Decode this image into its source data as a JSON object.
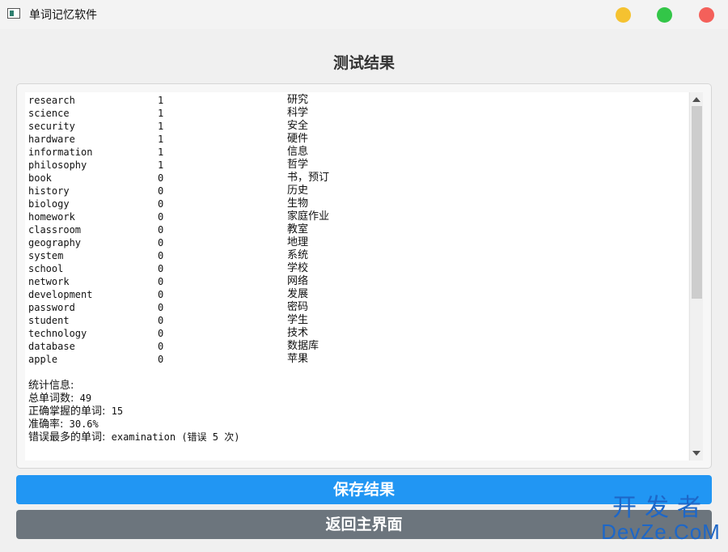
{
  "window": {
    "title": "单词记忆软件"
  },
  "heading": "测试结果",
  "results": [
    {
      "word": "research",
      "count": "1",
      "meaning": "研究"
    },
    {
      "word": "science",
      "count": "1",
      "meaning": "科学"
    },
    {
      "word": "security",
      "count": "1",
      "meaning": "安全"
    },
    {
      "word": "hardware",
      "count": "1",
      "meaning": "硬件"
    },
    {
      "word": "information",
      "count": "1",
      "meaning": "信息"
    },
    {
      "word": "philosophy",
      "count": "1",
      "meaning": "哲学"
    },
    {
      "word": "book",
      "count": "0",
      "meaning": "书，预订"
    },
    {
      "word": "history",
      "count": "0",
      "meaning": "历史"
    },
    {
      "word": "biology",
      "count": "0",
      "meaning": "生物"
    },
    {
      "word": "homework",
      "count": "0",
      "meaning": "家庭作业"
    },
    {
      "word": "classroom",
      "count": "0",
      "meaning": "教室"
    },
    {
      "word": "geography",
      "count": "0",
      "meaning": "地理"
    },
    {
      "word": "system",
      "count": "0",
      "meaning": "系统"
    },
    {
      "word": "school",
      "count": "0",
      "meaning": "学校"
    },
    {
      "word": "network",
      "count": "0",
      "meaning": "网络"
    },
    {
      "word": "development",
      "count": "0",
      "meaning": "发展"
    },
    {
      "word": "password",
      "count": "0",
      "meaning": "密码"
    },
    {
      "word": "student",
      "count": "0",
      "meaning": "学生"
    },
    {
      "word": "technology",
      "count": "0",
      "meaning": "技术"
    },
    {
      "word": "database",
      "count": "0",
      "meaning": "数据库"
    },
    {
      "word": "apple",
      "count": "0",
      "meaning": "苹果"
    }
  ],
  "stats": {
    "title": "统计信息:",
    "total_label": "总单词数:",
    "total_value": "49",
    "correct_label": "正确掌握的单词:",
    "correct_value": "15",
    "accuracy_label": "准确率:",
    "accuracy_value": "30.6%",
    "most_wrong_label": "错误最多的单词:",
    "most_wrong_value": "examination (错误 5 次)"
  },
  "buttons": {
    "save": "保存结果",
    "back": "返回主界面"
  },
  "watermark": {
    "cn": "开发者",
    "en": "DevZe.CoM"
  },
  "colors": {
    "save_button": "#2196f3",
    "back_button": "#6c757d",
    "close": "#f4605a",
    "minimize": "#f5c230",
    "maximize": "#33c648"
  },
  "icons": {
    "app": "window-app-icon",
    "scroll_up": "arrow-up-icon",
    "scroll_down": "arrow-down-icon"
  }
}
